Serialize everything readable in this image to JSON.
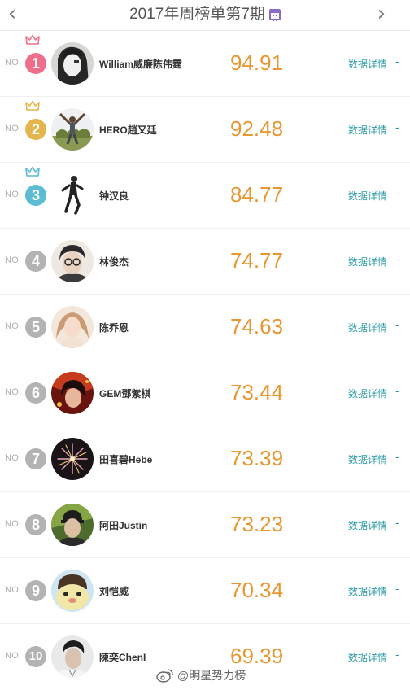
{
  "header": {
    "title": "2017年周榜单第7期",
    "prev_icon": "chevron-left-icon",
    "next_icon": "chevron-right-icon",
    "calendar_icon": "calendar-icon"
  },
  "rank_prefix": "NO.",
  "detail_label": "数据详情",
  "detail_suffix": "-",
  "colors": {
    "score": "#e8962f",
    "link": "#2e9ba6",
    "rank1": "#ee6f8c",
    "rank2": "#e3b54c",
    "rank3": "#5cbcd1",
    "rank_other": "#b3b3b3"
  },
  "rankings": [
    {
      "rank": "1",
      "name": "William威廉陈伟霆",
      "score": "94.91"
    },
    {
      "rank": "2",
      "name": "HERO趙又廷",
      "score": "92.48"
    },
    {
      "rank": "3",
      "name": "钟汉良",
      "score": "84.77"
    },
    {
      "rank": "4",
      "name": "林俊杰",
      "score": "74.77"
    },
    {
      "rank": "5",
      "name": "陈乔恩",
      "score": "74.63"
    },
    {
      "rank": "6",
      "name": "GEM鄧紫棋",
      "score": "73.44"
    },
    {
      "rank": "7",
      "name": "田喜碧Hebe",
      "score": "73.39"
    },
    {
      "rank": "8",
      "name": "阿田Justin",
      "score": "73.23"
    },
    {
      "rank": "9",
      "name": "刘恺威",
      "score": "70.34"
    },
    {
      "rank": "10",
      "name": "陳奕ChenI",
      "score": "69.39"
    }
  ],
  "watermark": {
    "text": "@明星势力榜",
    "icon": "weibo-icon"
  }
}
